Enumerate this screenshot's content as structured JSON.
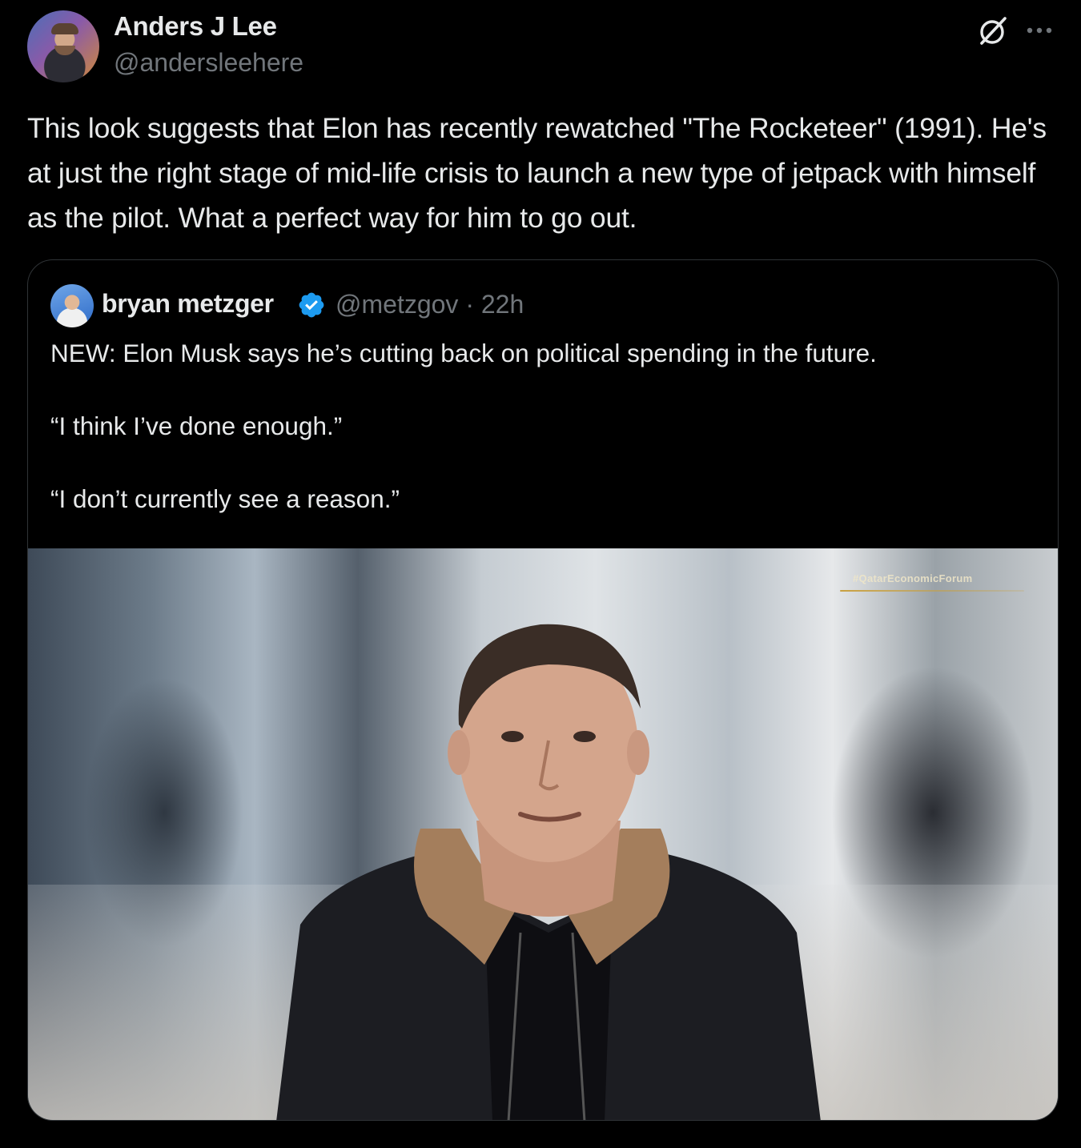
{
  "author": {
    "name": "Anders J Lee",
    "handle": "@andersleehere"
  },
  "tweet": {
    "text": "This look suggests that Elon has recently rewatched \"The Rocketeer\" (1991). He's at just the right stage of mid-life crisis to launch a new type of jetpack with himself as the pilot. What a perfect way for him to go out."
  },
  "icons": {
    "grok": "grok-icon",
    "more": "more-icon",
    "verified": "verified-badge-icon"
  },
  "quoted": {
    "name": "bryan metzger",
    "handle": "@metzgov",
    "separator": "·",
    "time": "22h",
    "text": "NEW: Elon Musk says he’s cutting back on political spending in the future.\n\n“I think I’ve done enough.”\n\n“I don’t currently see a reason.”",
    "media_watermark": "#QatarEconomicForum"
  },
  "colors": {
    "background": "#000000",
    "text": "#e7e9ea",
    "secondary": "#71767b",
    "border": "#2f3336",
    "verified": "#1d9bf0"
  }
}
